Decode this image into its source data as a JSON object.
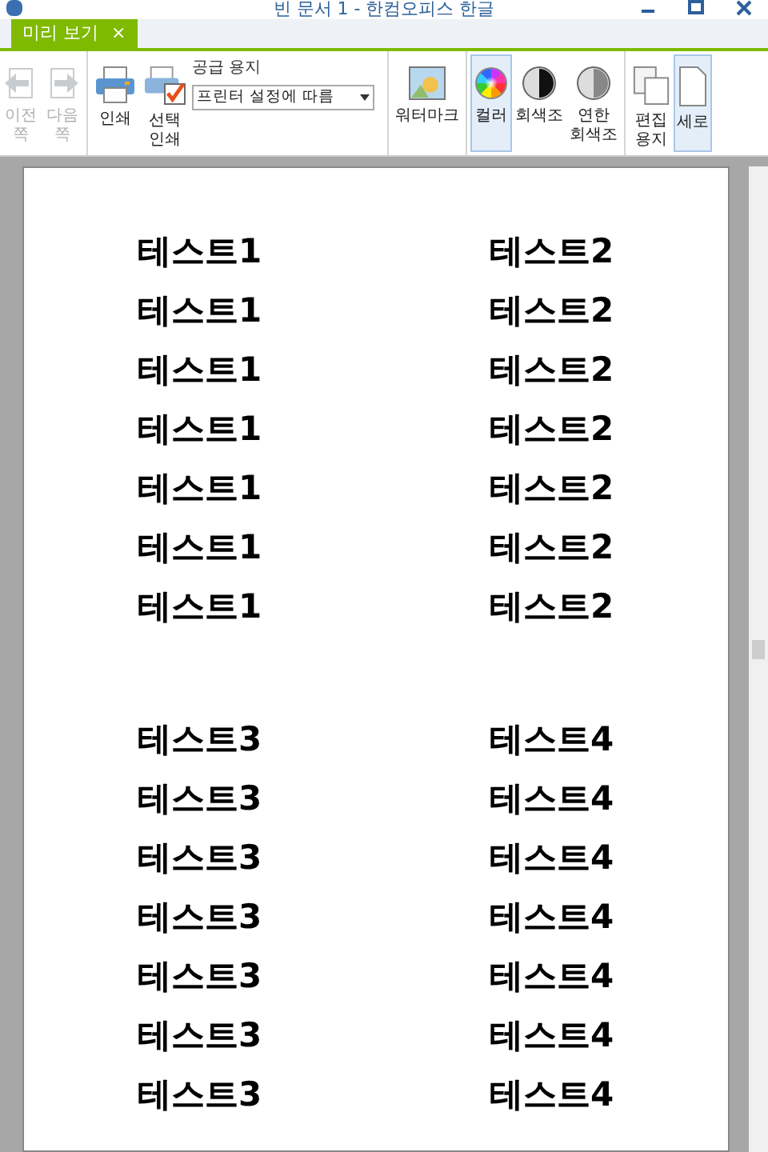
{
  "window": {
    "title": "빈 문서 1 - 한컴오피스 한글"
  },
  "tabs": [
    {
      "label": "미리 보기",
      "selected": true,
      "close": "×"
    }
  ],
  "toolbar": [
    {
      "kind": "prev",
      "lines": [
        "이전",
        "쪽"
      ],
      "disabled": true,
      "selected": false
    },
    {
      "kind": "next",
      "lines": [
        "다음",
        "쪽"
      ],
      "disabled": true,
      "selected": false
    },
    {
      "kind": "print",
      "lines": [
        "인쇄"
      ],
      "disabled": false,
      "selected": false
    },
    {
      "kind": "select-print",
      "lines": [
        "선택",
        "인쇄"
      ],
      "disabled": false,
      "selected": false
    },
    {
      "kind": "paper",
      "label": "공급 용지",
      "value": "프린터 설정에 따름"
    },
    {
      "kind": "watermark",
      "lines": [
        "워터마크"
      ],
      "disabled": false,
      "selected": false
    },
    {
      "kind": "color",
      "lines": [
        "컬러"
      ],
      "disabled": false,
      "selected": true
    },
    {
      "kind": "gray",
      "lines": [
        "회색조"
      ],
      "disabled": false,
      "selected": false
    },
    {
      "kind": "light-gray",
      "lines": [
        "연한",
        "회색조"
      ],
      "disabled": false,
      "selected": false
    },
    {
      "kind": "edit-paper",
      "lines": [
        "편집",
        "용지"
      ],
      "disabled": false,
      "selected": false
    },
    {
      "kind": "portrait",
      "lines": [
        "세로"
      ],
      "disabled": false,
      "selected": true
    }
  ],
  "page": {
    "blocks": [
      {
        "rows": [
          {
            "left": "테스트1",
            "right": "테스트2"
          },
          {
            "left": "테스트1",
            "right": "테스트2"
          },
          {
            "left": "테스트1",
            "right": "테스트2"
          },
          {
            "left": "테스트1",
            "right": "테스트2"
          },
          {
            "left": "테스트1",
            "right": "테스트2"
          },
          {
            "left": "테스트1",
            "right": "테스트2"
          },
          {
            "left": "테스트1",
            "right": "테스트2"
          }
        ]
      },
      {
        "rows": [
          {
            "left": "테스트3",
            "right": "테스트4"
          },
          {
            "left": "테스트3",
            "right": "테스트4"
          },
          {
            "left": "테스트3",
            "right": "테스트4"
          },
          {
            "left": "테스트3",
            "right": "테스트4"
          },
          {
            "left": "테스트3",
            "right": "테스트4"
          },
          {
            "left": "테스트3",
            "right": "테스트4"
          },
          {
            "left": "테스트3",
            "right": "테스트4"
          }
        ]
      }
    ]
  }
}
